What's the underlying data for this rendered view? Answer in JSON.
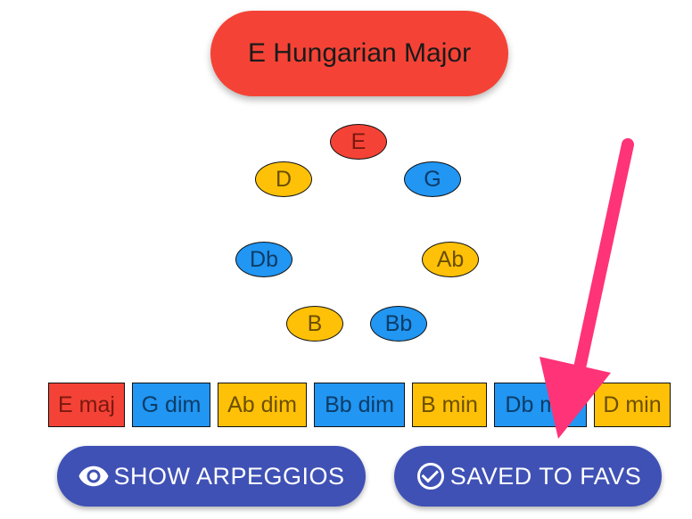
{
  "scale": {
    "title": "E Hungarian Major"
  },
  "notes": [
    "E",
    "G",
    "Ab",
    "Bb",
    "B",
    "Db",
    "D"
  ],
  "chords": [
    "E maj",
    "G dim",
    "Ab dim",
    "Bb dim",
    "B min",
    "Db min",
    "D min"
  ],
  "buttons": {
    "show_arpeggios": {
      "label": "SHOW ARPEGGIOS",
      "icon": "eye-icon"
    },
    "saved_to_favs": {
      "label": "SAVED TO FAVS",
      "icon": "check-circle-icon"
    }
  },
  "annotation": {
    "icon": "pointer-arrow",
    "color": "#ff3377"
  },
  "colors": {
    "title_bg": "#f44336",
    "root": "#f44336",
    "blue": "#2196f3",
    "yellow": "#ffc107",
    "button_bg": "#3f51b5"
  }
}
